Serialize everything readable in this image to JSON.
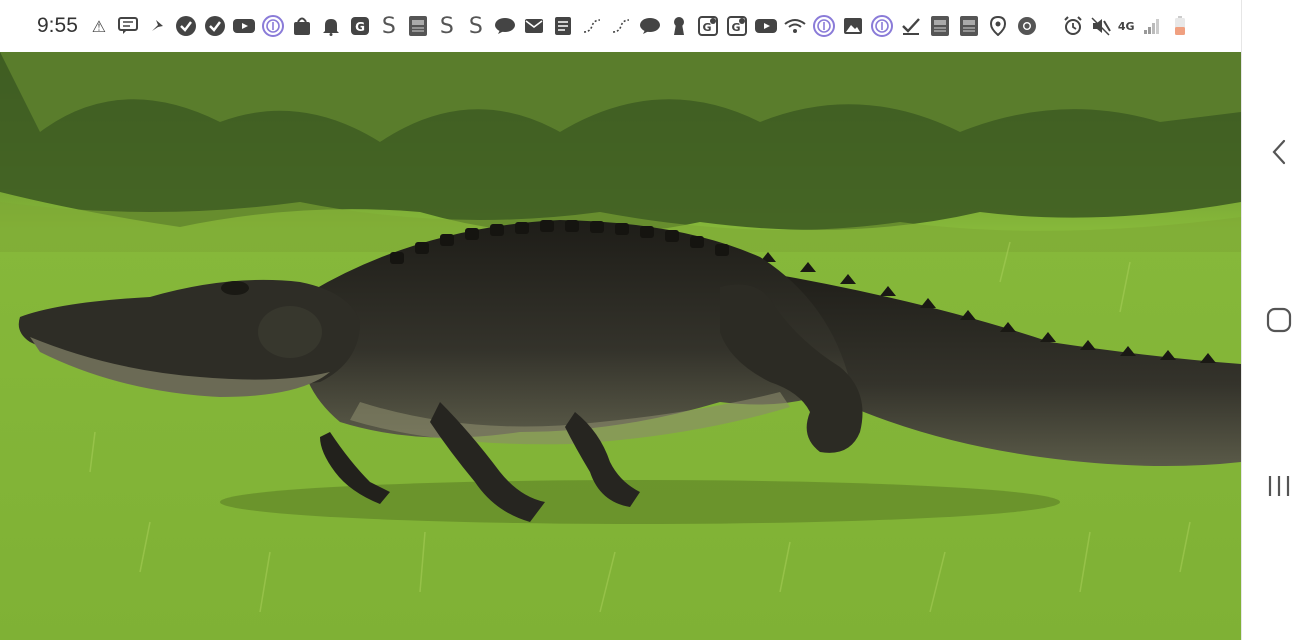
{
  "status_bar": {
    "time": "9:55",
    "notification_icons": [
      "alert-icon",
      "message-icon",
      "pin-icon",
      "vimeo-icon",
      "vimeo-icon",
      "youtube-icon",
      "fingerprint-icon",
      "bag-icon",
      "bell-icon",
      "g-icon",
      "s-icon",
      "news-icon",
      "s-icon",
      "s-icon",
      "chat-icon",
      "mail-icon",
      "document-icon",
      "route-icon",
      "route-icon",
      "chat-icon",
      "keyhole-icon",
      "map-g-icon",
      "map-g-icon",
      "youtube-icon",
      "wifi-icon",
      "fingerprint-icon",
      "image-icon",
      "fingerprint-icon",
      "check-icon",
      "news-icon",
      "news-icon",
      "location-icon",
      "chrome-icon"
    ],
    "network": "4G",
    "battery_color": "#f0a080"
  },
  "colors": {
    "grass": "#7fb038",
    "alligator": "#2b2a24",
    "ui_icon": "#555555"
  },
  "nav_bar": {
    "buttons": [
      "back-icon",
      "home-icon",
      "recents-icon"
    ]
  }
}
